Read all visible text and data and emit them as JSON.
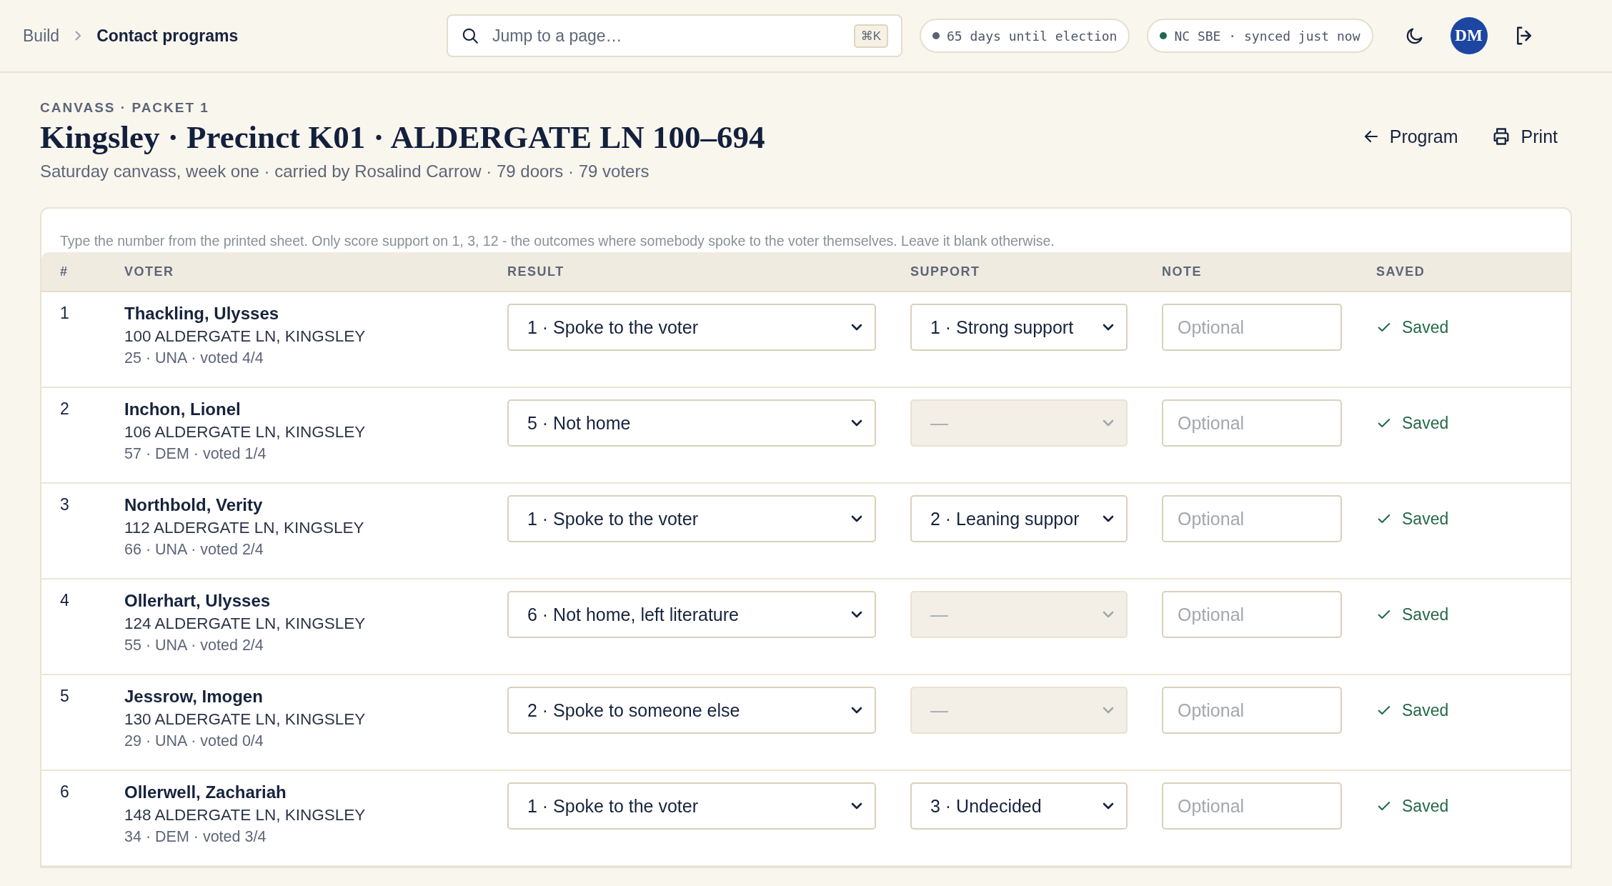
{
  "breadcrumb": [
    {
      "label": "Build",
      "selected": false
    },
    {
      "label": "Contact programs",
      "selected": true
    }
  ],
  "search": {
    "placeholder": "Jump to a page…",
    "shortcut": "⌘K"
  },
  "pills": [
    {
      "text": "65 days until election",
      "color": "#5b6270"
    },
    {
      "text": "NC SBE · synced just now",
      "color": "#23684a"
    }
  ],
  "avatar": "DM",
  "header": {
    "eyebrow": "CANVASS · PACKET 1",
    "title": "Kingsley · Precinct K01 · ALDERGATE LN 100–694",
    "subtitle": "Saturday canvass, week one · carried by Rosalind Carrow · 79 doors · 79 voters",
    "actions": [
      "Program",
      "Print"
    ]
  },
  "hint": "Type the number from the printed sheet. Only score support on 1, 3, 12 - the outcomes where somebody spoke to the voter themselves. Leave it blank otherwise.",
  "table": {
    "columns": [
      "#",
      "VOTER",
      "RESULT",
      "SUPPORT",
      "NOTE",
      "SAVED"
    ],
    "rows": [
      {
        "num": "1",
        "name": "Thackling, Ulysses",
        "address": "100 ALDERGATE LN, KINGSLEY",
        "meta": "25 · UNA · voted 4/4",
        "result": "1 · Spoke to the voter",
        "support": "1 · Strong support",
        "support_disabled": false,
        "note_placeholder": "Optional",
        "saved": "Saved"
      },
      {
        "num": "2",
        "name": "Inchon, Lionel",
        "address": "106 ALDERGATE LN, KINGSLEY",
        "meta": "57 · DEM · voted 1/4",
        "result": "5 · Not home",
        "support": "—",
        "support_disabled": true,
        "note_placeholder": "Optional",
        "saved": "Saved"
      },
      {
        "num": "3",
        "name": "Northbold, Verity",
        "address": "112 ALDERGATE LN, KINGSLEY",
        "meta": "66 · UNA · voted 2/4",
        "result": "1 · Spoke to the voter",
        "support": "2 · Leaning suppor",
        "support_disabled": false,
        "note_placeholder": "Optional",
        "saved": "Saved"
      },
      {
        "num": "4",
        "name": "Ollerhart, Ulysses",
        "address": "124 ALDERGATE LN, KINGSLEY",
        "meta": "55 · UNA · voted 2/4",
        "result": "6 · Not home, left literature",
        "support": "—",
        "support_disabled": true,
        "note_placeholder": "Optional",
        "saved": "Saved"
      },
      {
        "num": "5",
        "name": "Jessrow, Imogen",
        "address": "130 ALDERGATE LN, KINGSLEY",
        "meta": "29 · UNA · voted 0/4",
        "result": "2 · Spoke to someone else",
        "support": "—",
        "support_disabled": true,
        "note_placeholder": "Optional",
        "saved": "Saved"
      },
      {
        "num": "6",
        "name": "Ollerwell, Zachariah",
        "address": "148 ALDERGATE LN, KINGSLEY",
        "meta": "34 · DEM · voted 3/4",
        "result": "1 · Spoke to the voter",
        "support": "3 · Undecided",
        "support_disabled": false,
        "note_placeholder": "Optional",
        "saved": "Saved"
      }
    ]
  }
}
